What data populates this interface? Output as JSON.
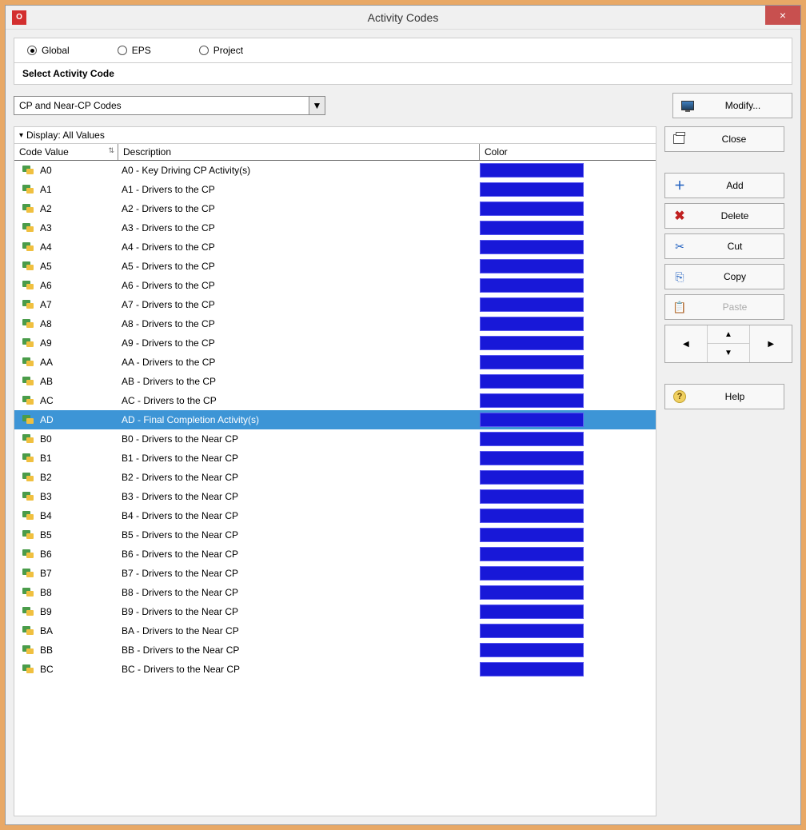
{
  "window": {
    "title": "Activity Codes",
    "close": "×"
  },
  "radios": {
    "global": "Global",
    "eps": "EPS",
    "project": "Project",
    "selected": "global"
  },
  "section_label": "Select Activity Code",
  "dropdown": {
    "value": "CP and Near-CP Codes"
  },
  "buttons": {
    "modify": "Modify...",
    "close": "Close",
    "add": "Add",
    "delete": "Delete",
    "cut": "Cut",
    "copy": "Copy",
    "paste": "Paste",
    "help": "Help"
  },
  "table": {
    "display_label": "Display: All Values",
    "headers": {
      "code": "Code Value",
      "desc": "Description",
      "color": "Color"
    },
    "selected_index": 13,
    "rows": [
      {
        "code": "A0",
        "desc": "A0 - Key Driving CP Activity(s)",
        "color": "#1818d8"
      },
      {
        "code": "A1",
        "desc": "A1 - Drivers to the CP",
        "color": "#1818d8"
      },
      {
        "code": "A2",
        "desc": "A2 - Drivers to the CP",
        "color": "#1818d8"
      },
      {
        "code": "A3",
        "desc": "A3 - Drivers to the CP",
        "color": "#1818d8"
      },
      {
        "code": "A4",
        "desc": "A4 - Drivers to the CP",
        "color": "#1818d8"
      },
      {
        "code": "A5",
        "desc": "A5 - Drivers to the CP",
        "color": "#1818d8"
      },
      {
        "code": "A6",
        "desc": "A6 - Drivers to the CP",
        "color": "#1818d8"
      },
      {
        "code": "A7",
        "desc": "A7 - Drivers to the CP",
        "color": "#1818d8"
      },
      {
        "code": "A8",
        "desc": "A8 - Drivers to the CP",
        "color": "#1818d8"
      },
      {
        "code": "A9",
        "desc": "A9 - Drivers to the CP",
        "color": "#1818d8"
      },
      {
        "code": "AA",
        "desc": "AA - Drivers to the CP",
        "color": "#1818d8"
      },
      {
        "code": "AB",
        "desc": "AB - Drivers to the CP",
        "color": "#1818d8"
      },
      {
        "code": "AC",
        "desc": "AC - Drivers to the CP",
        "color": "#1818d8"
      },
      {
        "code": "AD",
        "desc": "AD - Final Completion Activity(s)",
        "color": "#1818d8"
      },
      {
        "code": "B0",
        "desc": "B0 - Drivers to the Near CP",
        "color": "#1818d8"
      },
      {
        "code": "B1",
        "desc": "B1 - Drivers to the Near CP",
        "color": "#1818d8"
      },
      {
        "code": "B2",
        "desc": "B2 - Drivers to the Near CP",
        "color": "#1818d8"
      },
      {
        "code": "B3",
        "desc": "B3 - Drivers to the Near CP",
        "color": "#1818d8"
      },
      {
        "code": "B4",
        "desc": "B4 - Drivers to the Near CP",
        "color": "#1818d8"
      },
      {
        "code": "B5",
        "desc": "B5 - Drivers to the Near CP",
        "color": "#1818d8"
      },
      {
        "code": "B6",
        "desc": "B6 - Drivers to the Near CP",
        "color": "#1818d8"
      },
      {
        "code": "B7",
        "desc": "B7 - Drivers to the Near CP",
        "color": "#1818d8"
      },
      {
        "code": "B8",
        "desc": "B8 - Drivers to the Near CP",
        "color": "#1818d8"
      },
      {
        "code": "B9",
        "desc": "B9 - Drivers to the Near CP",
        "color": "#1818d8"
      },
      {
        "code": "BA",
        "desc": "BA - Drivers to the Near CP",
        "color": "#1818d8"
      },
      {
        "code": "BB",
        "desc": "BB - Drivers to the Near CP",
        "color": "#1818d8"
      },
      {
        "code": "BC",
        "desc": "BC - Drivers to the Near CP",
        "color": "#1818d8"
      }
    ]
  }
}
